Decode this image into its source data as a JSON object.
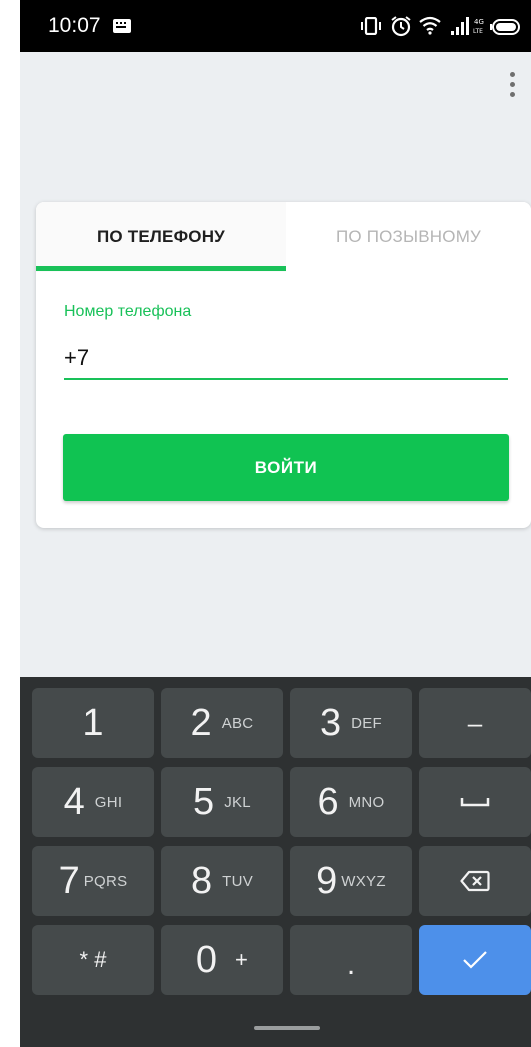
{
  "status_bar": {
    "time": "10:07"
  },
  "tabs": [
    {
      "label": "ПО ТЕЛЕФОНУ",
      "active": true
    },
    {
      "label": "ПО ПОЗЫВНОМУ",
      "active": false
    }
  ],
  "phone_field": {
    "label": "Номер телефона",
    "value": "+7"
  },
  "login_button": {
    "label": "ВОЙТИ"
  },
  "keyboard": {
    "keys": [
      {
        "digit": "1",
        "letters": ""
      },
      {
        "digit": "2",
        "letters": "ABC"
      },
      {
        "digit": "3",
        "letters": "DEF"
      },
      {
        "digit": "–",
        "letters": ""
      },
      {
        "digit": "4",
        "letters": "GHI"
      },
      {
        "digit": "5",
        "letters": "JKL"
      },
      {
        "digit": "6",
        "letters": "MNO"
      },
      {
        "digit": "",
        "letters": ""
      },
      {
        "digit": "7",
        "letters": "PQRS"
      },
      {
        "digit": "8",
        "letters": "TUV"
      },
      {
        "digit": "9",
        "letters": "WXYZ"
      },
      {
        "digit": "",
        "letters": ""
      },
      {
        "digit": "* #",
        "letters": ""
      },
      {
        "digit": "0",
        "letters": "+"
      },
      {
        "digit": ".",
        "letters": ""
      },
      {
        "digit": "",
        "letters": ""
      }
    ],
    "enter_color": "#4d90ea"
  },
  "colors": {
    "accent": "#19c159",
    "button": "#10c352",
    "background": "#eceff2",
    "keyboard": "#2e3132"
  }
}
